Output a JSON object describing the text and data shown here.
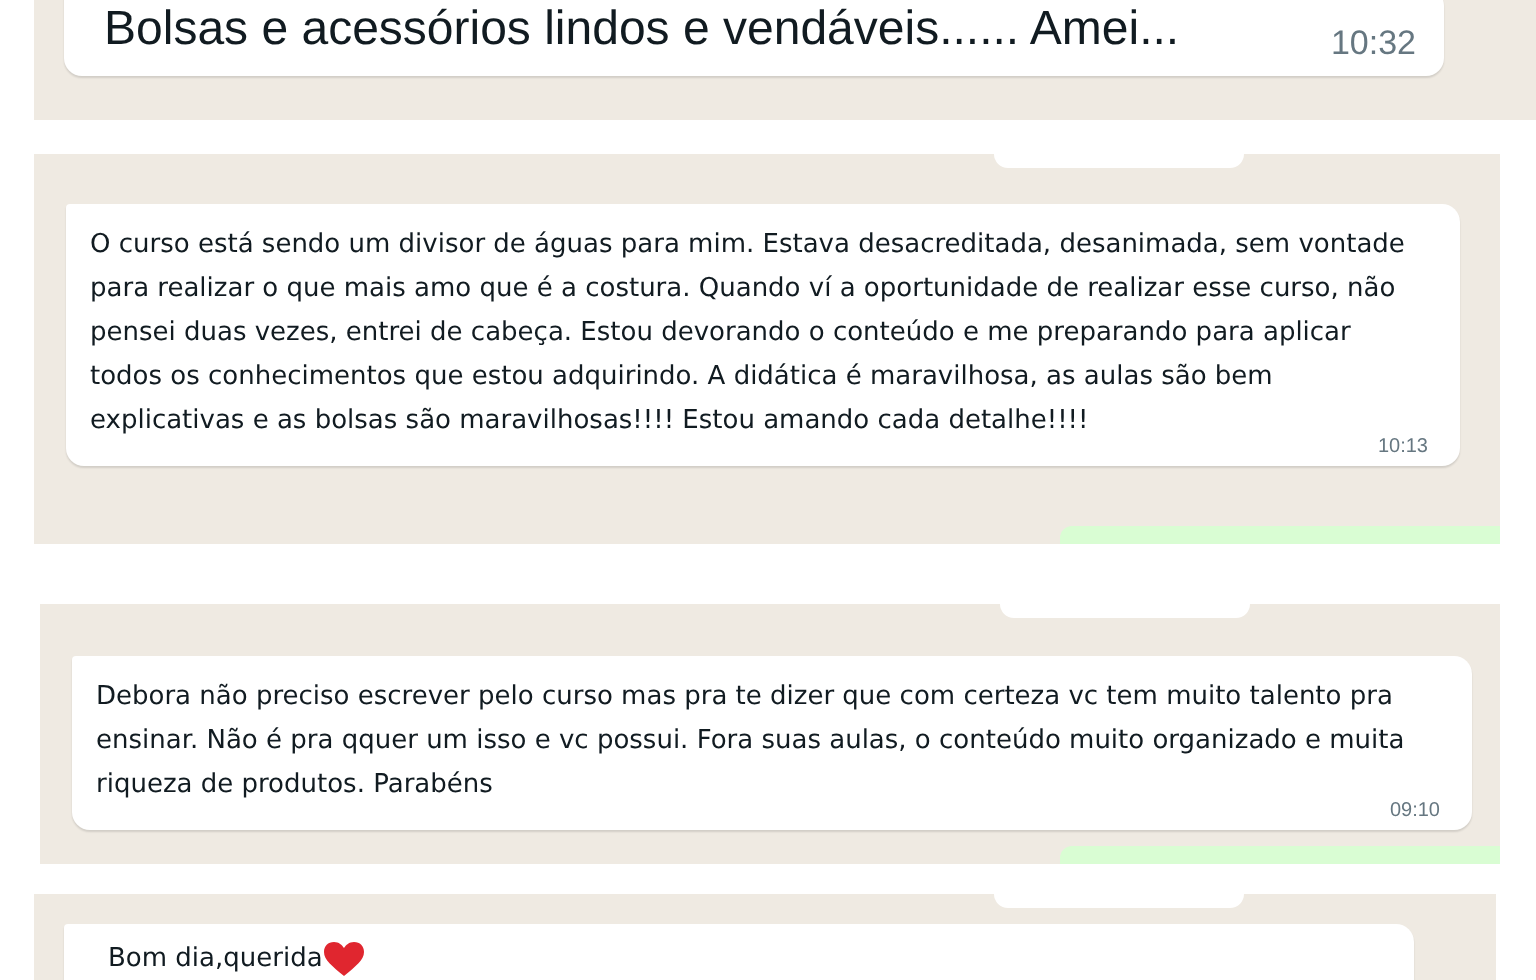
{
  "panels": [
    {
      "kind": "cut_top",
      "messages": [
        {
          "text": "Bolsas e acessórios lindos e vendáveis...... Amei...",
          "time": "10:32"
        }
      ]
    },
    {
      "kind": "full",
      "messages": [
        {
          "text": "O curso está sendo um divisor de águas para mim. Estava desacreditada, desanimada, sem vontade para realizar o que mais amo que é a costura. Quando ví a oportunidade de realizar esse curso, não pensei duas vezes, entrei de cabeça. Estou devorando o conteúdo e me preparando para aplicar todos os conhecimentos que estou adquirindo. A didática é maravilhosa, as aulas são bem explicativas e as bolsas são maravilhosas!!!! Estou amando cada detalhe!!!!",
          "time": "10:13"
        }
      ]
    },
    {
      "kind": "full",
      "messages": [
        {
          "text": "Debora não preciso escrever pelo curso mas pra te dizer que com certeza vc tem muito talento pra ensinar. Não é pra qquer um isso e vc possui. Fora suas aulas, o conteúdo muito organizado e muita riqueza de produtos. Parabéns",
          "time": "09:10"
        }
      ]
    },
    {
      "kind": "cut_bottom",
      "messages": [
        {
          "text": "Bom dia,querida",
          "heart": true
        }
      ]
    }
  ]
}
